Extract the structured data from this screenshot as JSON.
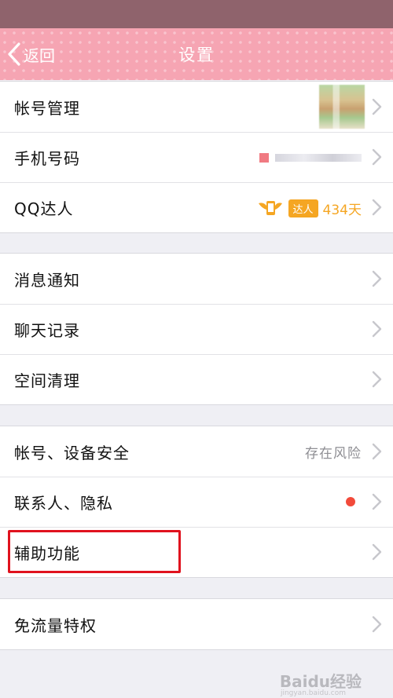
{
  "nav": {
    "back_label": "返回",
    "title": "设置"
  },
  "groups": [
    {
      "items": [
        {
          "label": "帐号管理"
        },
        {
          "label": "手机号码"
        },
        {
          "label": "QQ达人",
          "badge_label": "达人",
          "badge_days": "434天"
        }
      ]
    },
    {
      "items": [
        {
          "label": "消息通知"
        },
        {
          "label": "聊天记录"
        },
        {
          "label": "空间清理"
        }
      ]
    },
    {
      "items": [
        {
          "label": "帐号、设备安全",
          "detail": "存在风险"
        },
        {
          "label": "联系人、隐私"
        },
        {
          "label": "辅助功能"
        }
      ]
    },
    {
      "items": [
        {
          "label": "免流量特权"
        }
      ]
    }
  ],
  "watermark": {
    "brand": "Baidu经验",
    "sub": "jingyan.baidu.com"
  },
  "colors": {
    "navbar": "#f6a5b3",
    "statusbar": "#8f636c",
    "highlight": "#e0121e",
    "badge": "#f5a623",
    "reddot": "#f24a3a"
  }
}
